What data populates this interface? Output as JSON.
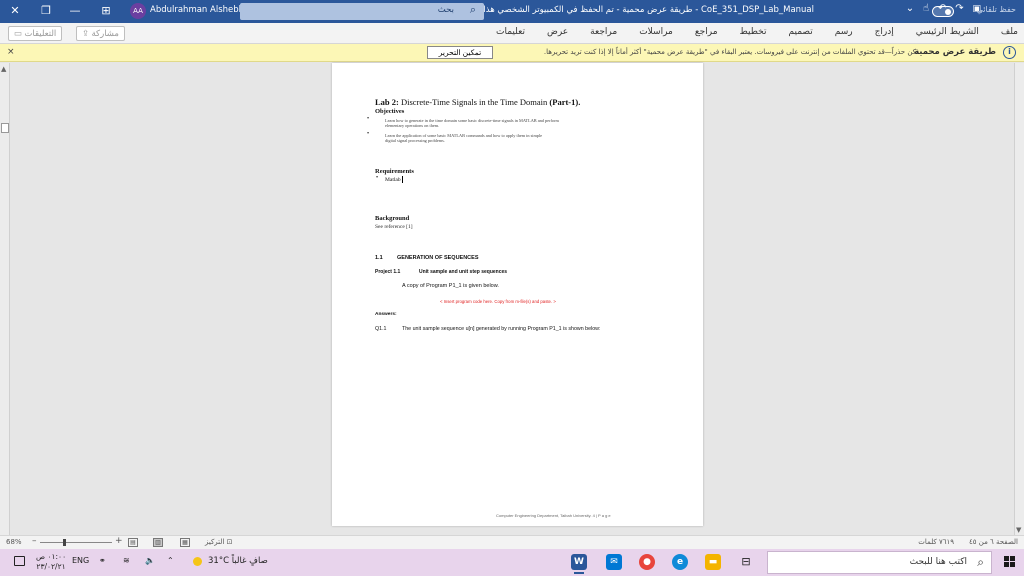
{
  "titlebar": {
    "user_initials": "AA",
    "user_name": "Abdulrahman Alshebli",
    "search_placeholder": "بحث",
    "doc_title": "CoE_351_DSP_Lab_Manual  -  طريقة عرض محمية  -  تم الحفظ في الكمبيوتر الشخصي هذا",
    "autosave": "حفظ تلقائي",
    "close_glyph": "✕",
    "restore_glyph": "❐",
    "minimize_glyph": "—",
    "layout_glyph": "⊞",
    "save_glyph": "💾",
    "undo_glyph": "↶",
    "redo_glyph": "↷",
    "touch_glyph": "☝",
    "more_glyph": "⌄"
  },
  "ribbon": {
    "tabs": [
      "ملف",
      "الشريط الرئيسي",
      "إدراج",
      "رسم",
      "تصميم",
      "تخطيط",
      "مراجع",
      "مراسلات",
      "مراجعة",
      "عرض",
      "تعليمات"
    ],
    "comments_label": "التعليقات",
    "share_label": "مشاركة"
  },
  "protected_view": {
    "icon": "i",
    "title": "طريقة عرض محمية",
    "message": "كن حذراً—قد تحتوي الملفات من إنترنت على فيروسات. يعتبر البقاء في \"طريقة عرض محمية\" أكثر أماناً إلا إذا كنت تريد تحريرها.",
    "enable_button": "تمكين التحرير",
    "close_glyph": "×"
  },
  "document": {
    "lab_title_bold": "Lab 2:",
    "lab_title_rest": " Discrete-Time Signals in the Time Domain ",
    "lab_title_part": "(Part-1).",
    "objectives": "Objectives",
    "bullet1_line1": "Learn how to generate in the time domain some basic discrete-time signals in MATLAB and perform",
    "bullet1_line2": "elementary operations on them.",
    "bullet2_line1": "Learn the application of some basic MATLAB commands and how to apply them in simple",
    "bullet2_line2": "digital signal processing problems.",
    "requirements": "Requirements",
    "req_item": "Matlab",
    "background": "Background",
    "reference": "See reference [1]",
    "section_num": "1.1",
    "section_title": "GENERATION OF SEQUENCES",
    "project_num": "Project 1.1",
    "project_title": "Unit sample and unit step sequences",
    "copy_text": "A copy of Program P1_1 is given below.",
    "insert_note": "< Insert program code here.  Copy from m-file(s) and paste. >",
    "answers": "Answers:",
    "q_num": "Q1.1",
    "q_text": "The unit sample sequence u[n] generated by running Program P1_1 is shown below:",
    "footer": "Computer Engineering Department, Taibah University. 4 | P a g e"
  },
  "statusbar": {
    "page_info": "الصفحة ٦ من ٤٥",
    "words": "٧٦١٩ كلمات",
    "zoom": "68%",
    "zoom_level": 0.68,
    "focus": "التركيز"
  },
  "taskbar": {
    "search_placeholder": "اكتب هنا للبحث",
    "weather": "31°C  صافٍ غالباً",
    "lang": "ENG",
    "time": "٠١:٠٠ ص",
    "date": "٢٣/٠٢/٢١"
  }
}
